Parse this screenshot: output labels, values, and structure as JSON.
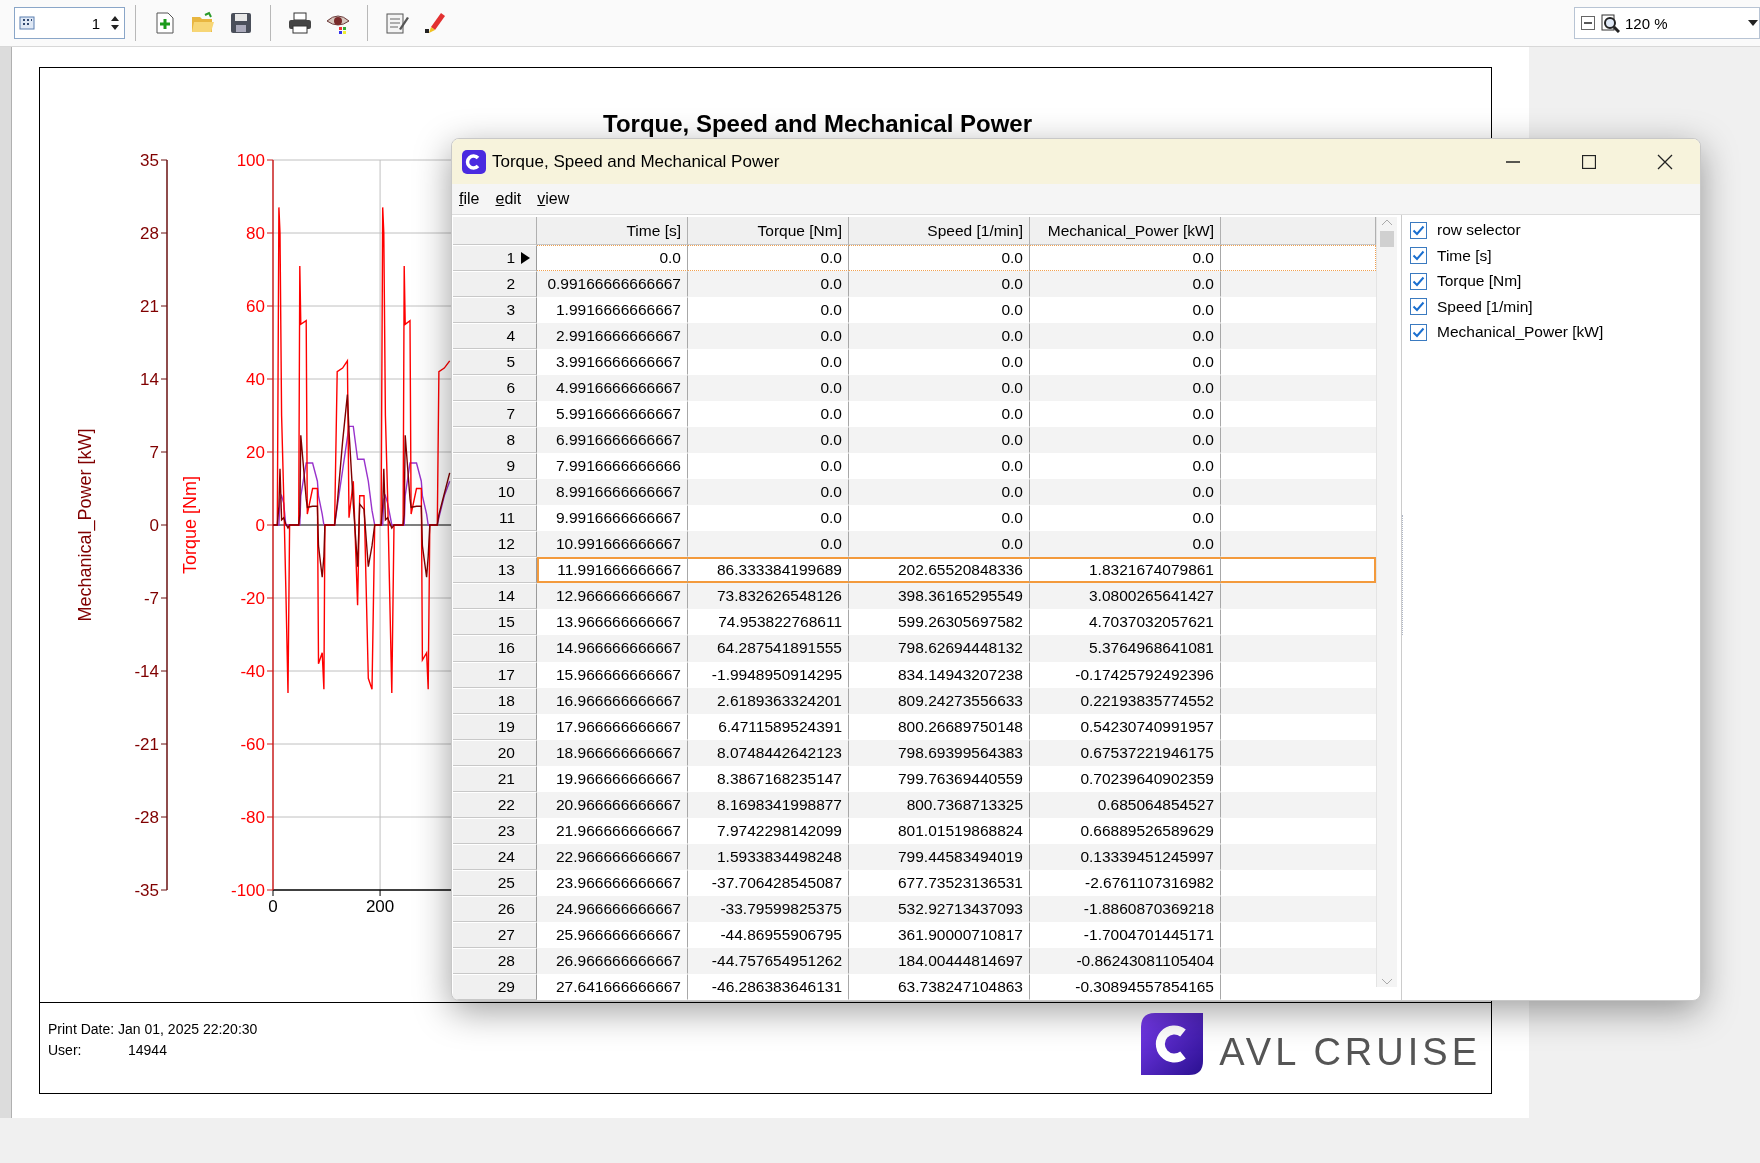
{
  "toolbar": {
    "page_field": {
      "value": "1"
    },
    "zoom_field": {
      "value": "120 %"
    }
  },
  "report": {
    "title": "Torque, Speed and Mechanical Power",
    "charts": [
      {
        "chart_data": {
          "type": "line",
          "grid": true,
          "ylabel": "Torque [Nm]",
          "xlim": [
            0,
            2180
          ],
          "ylim": [
            -100,
            100
          ],
          "yticks": [
            {
              "value": -100,
              "label": "-100"
            },
            {
              "value": -80,
              "label": "-80"
            },
            {
              "value": -60,
              "label": "-60"
            },
            {
              "value": -40,
              "label": "-40"
            },
            {
              "value": -20,
              "label": "-20"
            },
            {
              "value": 0,
              "label": "0"
            },
            {
              "value": 20,
              "label": "20"
            },
            {
              "value": 40,
              "label": "40"
            },
            {
              "value": 60,
              "label": "60"
            },
            {
              "value": 80,
              "label": "80"
            },
            {
              "value": 100,
              "label": "100"
            }
          ],
          "xticks": [
            {
              "value": 0,
              "label": "0"
            },
            {
              "value": 200,
              "label": "200"
            }
          ],
          "x": [
            0,
            8,
            11,
            13,
            16,
            20,
            24,
            28,
            31,
            48,
            50,
            52,
            62,
            64,
            74,
            83,
            85,
            92,
            95,
            97,
            115,
            120,
            130,
            139,
            142,
            150,
            158,
            162,
            170,
            178,
            185,
            190,
            202,
            205,
            207,
            210,
            214,
            222,
            226,
            243,
            245,
            247,
            256,
            258,
            268,
            277,
            279,
            287,
            290,
            293,
            307,
            310,
            320,
            330
          ],
          "series": [
            {
              "color": "#9933cc",
              "values": [
                0,
                0,
                0,
                7,
                8,
                6,
                0,
                0,
                0,
                0,
                0,
                8,
                17,
                17,
                17,
                12,
                8,
                3,
                0,
                0,
                0,
                5,
                15,
                24,
                27,
                27,
                18,
                18,
                18,
                12,
                4,
                0,
                0,
                0,
                7,
                8,
                6,
                0,
                0,
                0,
                0,
                8,
                17,
                17,
                17,
                12,
                8,
                3,
                0,
                0,
                0,
                2,
                8,
                12
              ]
            },
            {
              "color": "#ff0000",
              "values": [
                0,
                0,
                87,
                80,
                30,
                8,
                -17,
                -46,
                0,
                0,
                71,
                55,
                56,
                3,
                10,
                10,
                -38,
                -35,
                -45,
                0,
                0,
                42,
                43,
                45,
                2,
                12,
                -22,
                8,
                8,
                -42,
                -45,
                0,
                0,
                87,
                80,
                30,
                8,
                -46,
                0,
                0,
                71,
                55,
                56,
                3,
                10,
                10,
                -37,
                -35,
                -45,
                0,
                0,
                42,
                43,
                45
              ]
            }
          ]
        }
      },
      {
        "chart_data": {
          "type": "line",
          "ylabel": "Mechanical_Power [kW]",
          "xlim": [
            0,
            2180
          ],
          "ylim": [
            -35,
            35
          ],
          "yticks": [
            {
              "value": -35,
              "label": "-35"
            },
            {
              "value": -28,
              "label": "-28"
            },
            {
              "value": -21,
              "label": "-21"
            },
            {
              "value": -14,
              "label": "-14"
            },
            {
              "value": -7,
              "label": "-7"
            },
            {
              "value": 0,
              "label": "0"
            },
            {
              "value": 7,
              "label": "7"
            },
            {
              "value": 14,
              "label": "14"
            },
            {
              "value": 21,
              "label": "21"
            },
            {
              "value": 28,
              "label": "28"
            },
            {
              "value": 35,
              "label": "35"
            }
          ],
          "x": [
            0,
            8,
            11,
            13,
            16,
            20,
            24,
            28,
            31,
            48,
            50,
            52,
            62,
            64,
            74,
            83,
            85,
            92,
            95,
            97,
            115,
            120,
            130,
            139,
            142,
            150,
            158,
            162,
            170,
            178,
            185,
            190,
            202,
            205,
            207,
            210,
            214,
            222,
            226,
            243,
            245,
            247,
            256,
            258,
            268,
            277,
            279,
            287,
            290,
            293,
            307,
            310,
            320,
            330
          ],
          "series": [
            {
              "color": "#800000",
              "values": [
                0,
                0,
                1.8,
                5.4,
                0.5,
                0.7,
                0.1,
                -0.3,
                0,
                0,
                1,
                8.6,
                2.5,
                1.7,
                1.8,
                1.8,
                -2,
                -5,
                -3,
                0,
                0,
                2,
                8,
                12.5,
                9,
                2,
                -4,
                2,
                1.5,
                -4,
                -2,
                0,
                0,
                1.8,
                5.4,
                0.5,
                0.7,
                -0.3,
                0,
                0,
                1,
                8.6,
                2.5,
                1.7,
                1.8,
                1.8,
                -2,
                -5,
                -3,
                0,
                0,
                1,
                3,
                5
              ]
            }
          ]
        }
      }
    ],
    "footer": {
      "print_date": "Print Date: Jan 01, 2025 22:20:30",
      "user_label": "User:",
      "user_value": "14944"
    },
    "logo_text": "AVL CRUISE"
  },
  "dialog": {
    "title": "Torque, Speed and Mechanical Power",
    "menu": [
      "file",
      "edit",
      "view"
    ],
    "table": {
      "columns": [
        "Time [s]",
        "Torque [Nm]",
        "Speed [1/min]",
        "Mechanical_Power [kW]"
      ],
      "rows": [
        {
          "number": "1",
          "current": true,
          "selected": false,
          "cells": [
            "0.0",
            "0.0",
            "0.0",
            "0.0"
          ]
        },
        {
          "number": "2",
          "current": false,
          "selected": false,
          "cells": [
            "0.99166666666667",
            "0.0",
            "0.0",
            "0.0"
          ]
        },
        {
          "number": "3",
          "current": false,
          "selected": false,
          "cells": [
            "1.9916666666667",
            "0.0",
            "0.0",
            "0.0"
          ]
        },
        {
          "number": "4",
          "current": false,
          "selected": false,
          "cells": [
            "2.9916666666667",
            "0.0",
            "0.0",
            "0.0"
          ]
        },
        {
          "number": "5",
          "current": false,
          "selected": false,
          "cells": [
            "3.9916666666667",
            "0.0",
            "0.0",
            "0.0"
          ]
        },
        {
          "number": "6",
          "current": false,
          "selected": false,
          "cells": [
            "4.9916666666667",
            "0.0",
            "0.0",
            "0.0"
          ]
        },
        {
          "number": "7",
          "current": false,
          "selected": false,
          "cells": [
            "5.9916666666667",
            "0.0",
            "0.0",
            "0.0"
          ]
        },
        {
          "number": "8",
          "current": false,
          "selected": false,
          "cells": [
            "6.9916666666667",
            "0.0",
            "0.0",
            "0.0"
          ]
        },
        {
          "number": "9",
          "current": false,
          "selected": false,
          "cells": [
            "7.9916666666666",
            "0.0",
            "0.0",
            "0.0"
          ]
        },
        {
          "number": "10",
          "current": false,
          "selected": false,
          "cells": [
            "8.9916666666667",
            "0.0",
            "0.0",
            "0.0"
          ]
        },
        {
          "number": "11",
          "current": false,
          "selected": false,
          "cells": [
            "9.9916666666667",
            "0.0",
            "0.0",
            "0.0"
          ]
        },
        {
          "number": "12",
          "current": false,
          "selected": false,
          "cells": [
            "10.991666666667",
            "0.0",
            "0.0",
            "0.0"
          ]
        },
        {
          "number": "13",
          "current": false,
          "selected": true,
          "cells": [
            "11.991666666667",
            "86.333384199689",
            "202.65520848336",
            "1.8321674079861"
          ]
        },
        {
          "number": "14",
          "current": false,
          "selected": false,
          "cells": [
            "12.966666666667",
            "73.832626548126",
            "398.36165295549",
            "3.0800265641427"
          ]
        },
        {
          "number": "15",
          "current": false,
          "selected": false,
          "cells": [
            "13.966666666667",
            "74.953822768611",
            "599.26305697582",
            "4.7037032057621"
          ]
        },
        {
          "number": "16",
          "current": false,
          "selected": false,
          "cells": [
            "14.966666666667",
            "64.287541891555",
            "798.62694448132",
            "5.3764968641081"
          ]
        },
        {
          "number": "17",
          "current": false,
          "selected": false,
          "cells": [
            "15.966666666667",
            "-1.9948950914295",
            "834.14943207238",
            "-0.17425792492396"
          ]
        },
        {
          "number": "18",
          "current": false,
          "selected": false,
          "cells": [
            "16.966666666667",
            "2.6189363324201",
            "809.24273556633",
            "0.22193835774552"
          ]
        },
        {
          "number": "19",
          "current": false,
          "selected": false,
          "cells": [
            "17.966666666667",
            "6.4711589524391",
            "800.26689750148",
            "0.54230740991957"
          ]
        },
        {
          "number": "20",
          "current": false,
          "selected": false,
          "cells": [
            "18.966666666667",
            "8.0748442642123",
            "798.69399564383",
            "0.67537221946175"
          ]
        },
        {
          "number": "21",
          "current": false,
          "selected": false,
          "cells": [
            "19.966666666667",
            "8.3867168235147",
            "799.76369440559",
            "0.70239640902359"
          ]
        },
        {
          "number": "22",
          "current": false,
          "selected": false,
          "cells": [
            "20.966666666667",
            "8.1698341998877",
            "800.7368713325",
            "0.685064854527"
          ]
        },
        {
          "number": "23",
          "current": false,
          "selected": false,
          "cells": [
            "21.966666666667",
            "7.9742298142099",
            "801.01519868824",
            "0.66889526589629"
          ]
        },
        {
          "number": "24",
          "current": false,
          "selected": false,
          "cells": [
            "22.966666666667",
            "1.5933834498248",
            "799.44583494019",
            "0.13339451245997"
          ]
        },
        {
          "number": "25",
          "current": false,
          "selected": false,
          "cells": [
            "23.966666666667",
            "-37.706428545087",
            "677.73523136531",
            "-2.6761107316982"
          ]
        },
        {
          "number": "26",
          "current": false,
          "selected": false,
          "cells": [
            "24.966666666667",
            "-33.79599825375",
            "532.92713437093",
            "-1.8860870369218"
          ]
        },
        {
          "number": "27",
          "current": false,
          "selected": false,
          "cells": [
            "25.966666666667",
            "-44.86955906795",
            "361.90000710817",
            "-1.7004701445171"
          ]
        },
        {
          "number": "28",
          "current": false,
          "selected": false,
          "cells": [
            "26.966666666667",
            "-44.757654951262",
            "184.00444814697",
            "-0.86243081105404"
          ]
        },
        {
          "number": "29",
          "current": false,
          "selected": false,
          "cells": [
            "27.641666666667",
            "-46.286383646131",
            "63.738247104863",
            "-0.30894557854165"
          ]
        }
      ]
    },
    "column_chooser": [
      {
        "label": "row selector",
        "checked": true
      },
      {
        "label": "Time [s]",
        "checked": true
      },
      {
        "label": "Torque [Nm]",
        "checked": true
      },
      {
        "label": "Speed [1/min]",
        "checked": true
      },
      {
        "label": "Mechanical_Power [kW]",
        "checked": true
      }
    ]
  }
}
